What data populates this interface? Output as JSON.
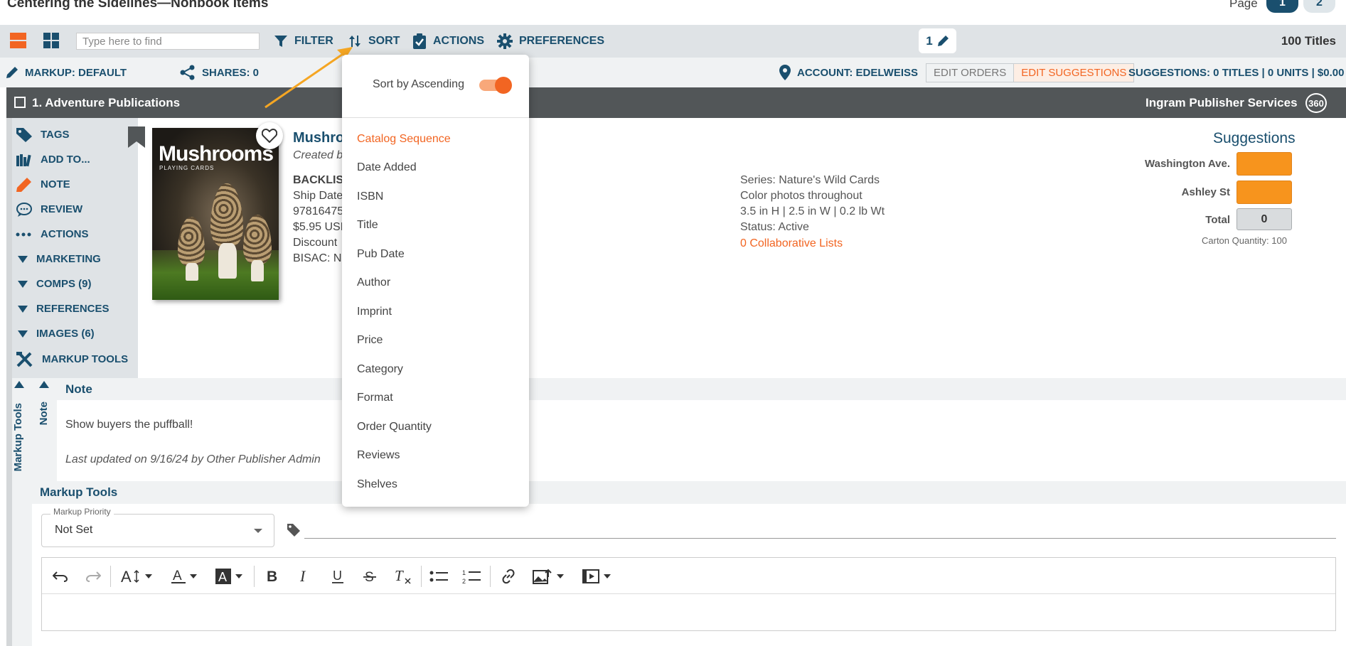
{
  "header": {
    "catalog_title": "Centering the Sidelines—Nonbook Items",
    "page_label": "Page",
    "pages": [
      "1",
      "2"
    ]
  },
  "toolbar": {
    "search_placeholder": "Type here to find",
    "filter_label": "FILTER",
    "sort_label": "SORT",
    "actions_label": "ACTIONS",
    "preferences_label": "PREFERENCES",
    "selection_count": "1",
    "titles_count": "100 Titles"
  },
  "markup_bar": {
    "markup_label": "MARKUP: DEFAULT",
    "shares_label": "SHARES: 0",
    "account_label": "ACCOUNT: EDELWEISS",
    "edit_orders": "EDIT ORDERS",
    "edit_suggestions": "EDIT SUGGESTIONS",
    "suggestions_summary": "SUGGESTIONS: 0 TITLES | 0 UNITS | $0.00"
  },
  "title_row": {
    "label": "1. Adventure Publications",
    "distributor": "Ingram Publisher Services",
    "badge": "360"
  },
  "sidebar": {
    "items": [
      {
        "label": "TAGS"
      },
      {
        "label": "ADD TO..."
      },
      {
        "label": "NOTE"
      },
      {
        "label": "REVIEW"
      },
      {
        "label": "ACTIONS"
      },
      {
        "label": "MARKETING"
      },
      {
        "label": "COMPS (9)"
      },
      {
        "label": "REFERENCES"
      },
      {
        "label": "IMAGES (6)"
      },
      {
        "label": "MARKUP TOOLS"
      }
    ]
  },
  "product": {
    "cover_title": "Mushrooms",
    "cover_subtitle": "PLAYING CARDS",
    "title": "Mushro",
    "byline": "Created b",
    "status": "BACKLIST",
    "ship_date": "Ship Date",
    "isbn": "97816475",
    "price": "$5.95 USD",
    "discount": "Discount",
    "bisac": "BISAC: Na",
    "series": "Series: Nature's Wild Cards",
    "photos": "Color photos throughout",
    "dimensions": "3.5 in H | 2.5 in W | 0.2 lb Wt",
    "product_status": "Status: Active",
    "collaborative_lists": "0 Collaborative Lists"
  },
  "suggestions": {
    "title": "Suggestions",
    "stores": [
      {
        "name": "Washington Ave."
      },
      {
        "name": "Ashley St"
      }
    ],
    "total_label": "Total",
    "total_value": "0",
    "carton_quantity": "Carton Quantity: 100"
  },
  "note": {
    "rail_label": "Markup Tools",
    "tab_label": "Note",
    "heading": "Note",
    "text": "Show buyers the puffball!",
    "updated": "Last updated on 9/16/24 by Other Publisher Admin"
  },
  "markup_tools": {
    "heading": "Markup Tools",
    "priority_legend": "Markup Priority",
    "priority_value": "Not Set"
  },
  "sort_menu": {
    "ascending_label": "Sort by Ascending",
    "ascending_on": true,
    "options": [
      "Catalog Sequence",
      "Date Added",
      "ISBN",
      "Title",
      "Pub Date",
      "Author",
      "Imprint",
      "Price",
      "Category",
      "Format",
      "Order Quantity",
      "Reviews",
      "Shelves"
    ],
    "selected": "Catalog Sequence"
  },
  "colors": {
    "navy": "#1a4f6e",
    "accent_orange": "#f26522",
    "suggestion_orange": "#f7941d",
    "annotation_arrow": "#f5a623"
  }
}
